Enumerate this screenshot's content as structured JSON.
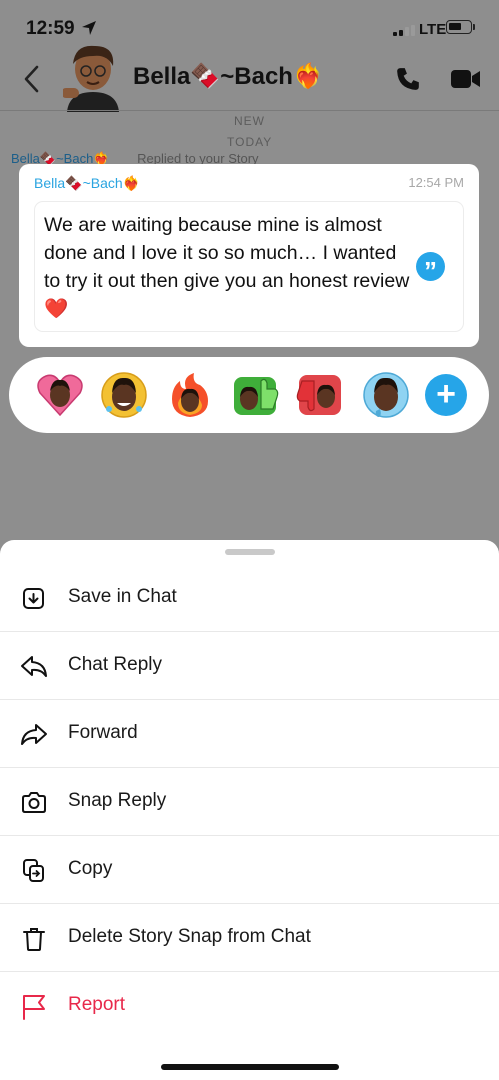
{
  "status_bar": {
    "time": "12:59",
    "network": "LTE"
  },
  "chat": {
    "contact_name": "Bella🍫~Bach❤️‍🔥",
    "separator_new": "NEW",
    "separator_today": "TODAY",
    "replied_sender": "Bella🍫~Bach❤️‍🔥",
    "replied_text": "Replied to your Story"
  },
  "message": {
    "sender": "Bella🍫~Bach❤️‍🔥",
    "time": "12:54 PM",
    "text": "We are waiting because mine is almost done and I love it so so much… I wanted to try it out then give you an honest review❤️"
  },
  "reactions": [
    "heart-eyes-bitmoji",
    "laughing-bitmoji",
    "fire-bitmoji",
    "thumbs-up-bitmoji",
    "thumbs-down-bitmoji",
    "crying-bitmoji",
    "add-reaction"
  ],
  "menu": {
    "items": [
      {
        "label": "Save in Chat",
        "icon": "save-in-chat-icon"
      },
      {
        "label": "Chat Reply",
        "icon": "reply-arrow-icon"
      },
      {
        "label": "Forward",
        "icon": "forward-arrow-icon"
      },
      {
        "label": "Snap Reply",
        "icon": "camera-icon"
      },
      {
        "label": "Copy",
        "icon": "copy-icon"
      },
      {
        "label": "Delete Story Snap from Chat",
        "icon": "trash-icon"
      },
      {
        "label": "Report",
        "icon": "flag-icon"
      }
    ]
  },
  "colors": {
    "accent": "#26a5e8",
    "danger": "#e8284a",
    "sender": "#2aa4e0"
  }
}
